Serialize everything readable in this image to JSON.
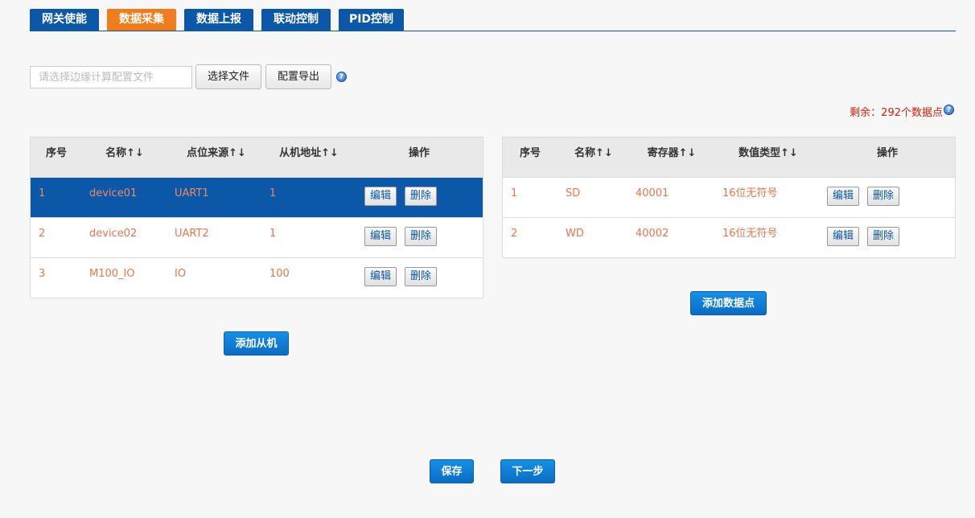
{
  "tabs": [
    {
      "label": "网关使能",
      "active": false
    },
    {
      "label": "数据采集",
      "active": true
    },
    {
      "label": "数据上报",
      "active": false
    },
    {
      "label": "联动控制",
      "active": false
    },
    {
      "label": "PID控制",
      "active": false
    }
  ],
  "config": {
    "file_placeholder": "请选择边缘计算配置文件",
    "choose_file_label": "选择文件",
    "export_label": "配置导出",
    "help_icon": "?"
  },
  "remaining": {
    "text": "剩余：292个数据点",
    "color": "#d81e06"
  },
  "slave_table": {
    "headers": [
      "序号",
      "名称↑↓",
      "点位来源↑↓",
      "从机地址↑↓",
      "操作"
    ],
    "rows": [
      {
        "index": "1",
        "name": "device01",
        "source": "UART1",
        "address": "1",
        "selected": true
      },
      {
        "index": "2",
        "name": "device02",
        "source": "UART2",
        "address": "1",
        "selected": false
      },
      {
        "index": "3",
        "name": "M100_IO",
        "source": "IO",
        "address": "100",
        "selected": false
      }
    ],
    "edit_label": "编辑",
    "delete_label": "删除",
    "add_label": "添加从机"
  },
  "point_table": {
    "headers": [
      "序号",
      "名称↑↓",
      "寄存器↑↓",
      "数值类型↑↓",
      "操作"
    ],
    "rows": [
      {
        "index": "1",
        "name": "SD",
        "register": "40001",
        "type": "16位无符号"
      },
      {
        "index": "2",
        "name": "WD",
        "register": "40002",
        "type": "16位无符号"
      }
    ],
    "edit_label": "编辑",
    "delete_label": "删除",
    "add_label": "添加数据点"
  },
  "footer": {
    "save_label": "保存",
    "next_label": "下一步"
  },
  "colors": {
    "primary": "#0b57a8",
    "active_tab": "#f07c1b",
    "cell_text": "#e8764b"
  }
}
